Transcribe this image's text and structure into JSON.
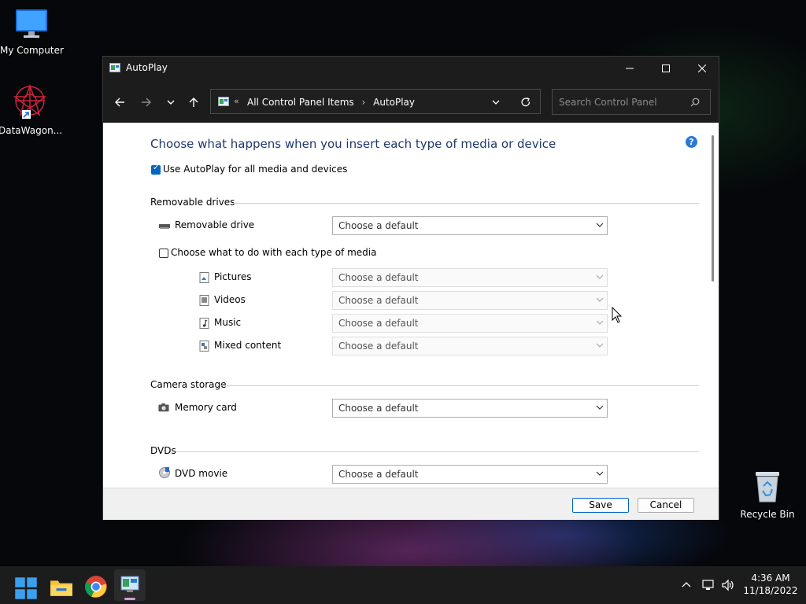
{
  "desktop": {
    "icons": [
      {
        "label": "My Computer",
        "icon": "monitor-icon"
      },
      {
        "label": "DataWagon...",
        "icon": "datawagon-icon"
      },
      {
        "label": "Recycle Bin",
        "icon": "recycle-bin-icon"
      }
    ]
  },
  "window": {
    "title": "AutoPlay",
    "breadcrumb_root": "All Control Panel Items",
    "breadcrumb_current": "AutoPlay",
    "search_placeholder": "Search Control Panel",
    "heading": "Choose what happens when you insert each type of media or device",
    "use_autoplay_label": "Use AutoPlay for all media and devices",
    "use_autoplay_checked": true,
    "sections": {
      "removable": "Removable drives",
      "camera": "Camera storage",
      "dvds": "DVDs"
    },
    "rows": {
      "removable_drive": {
        "label": "Removable drive",
        "value": "Choose a default"
      },
      "each_media_label": "Choose what to do with each type of media",
      "pictures": {
        "label": "Pictures",
        "value": "Choose a default"
      },
      "videos": {
        "label": "Videos",
        "value": "Choose a default"
      },
      "music": {
        "label": "Music",
        "value": "Choose a default"
      },
      "mixed": {
        "label": "Mixed content",
        "value": "Choose a default"
      },
      "memory_card": {
        "label": "Memory card",
        "value": "Choose a default"
      },
      "dvd_movie": {
        "label": "DVD movie",
        "value": "Choose a default"
      }
    },
    "save_label": "Save",
    "cancel_label": "Cancel"
  },
  "taskbar": {
    "time": "4:36 AM",
    "date": "11/18/2022"
  },
  "colors": {
    "accent": "#0067c0",
    "heading": "#1e3a6b"
  }
}
